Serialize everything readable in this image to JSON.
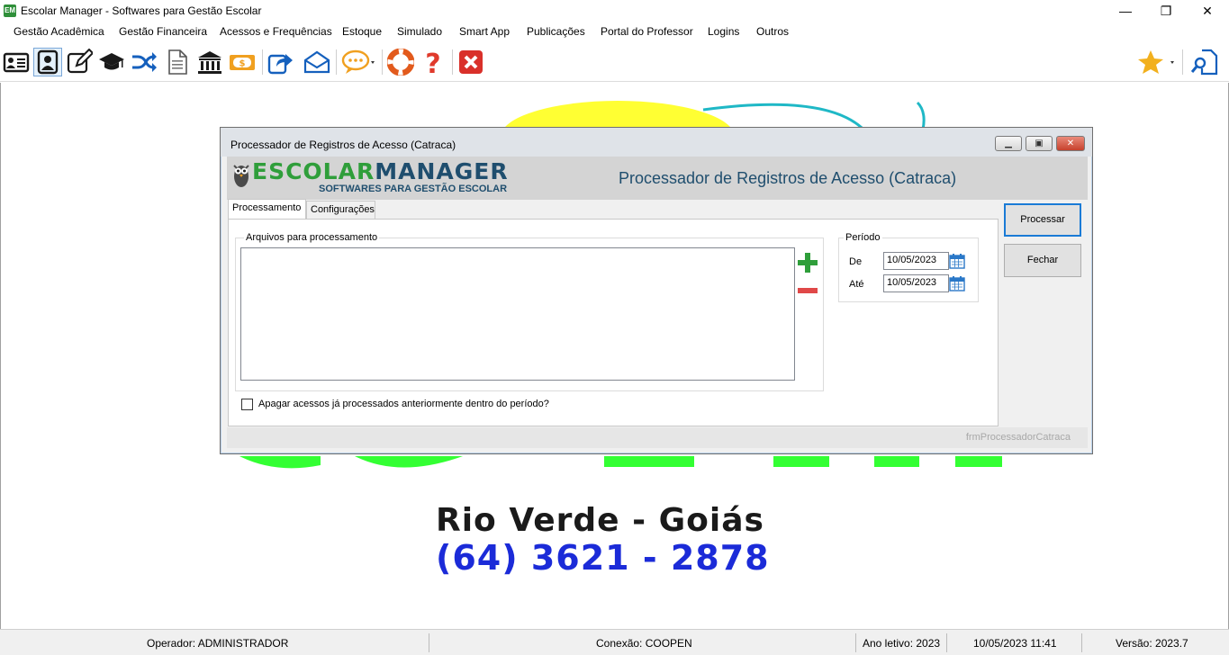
{
  "app": {
    "title": "Escolar Manager - Softwares para Gestão Escolar",
    "window_controls": {
      "minimize": "—",
      "maximize": "❐",
      "close": "✕"
    }
  },
  "menu": [
    {
      "label": "Gestão Acadêmica"
    },
    {
      "label": "Gestão Financeira"
    },
    {
      "label": "Acessos e Frequências"
    },
    {
      "label": "Estoque"
    },
    {
      "label": "Simulado"
    },
    {
      "label": "Smart App"
    },
    {
      "label": "Publicações"
    },
    {
      "label": "Portal do Professor"
    },
    {
      "label": "Logins"
    },
    {
      "label": "Outros"
    }
  ],
  "toolbar": {
    "icons": [
      "id-card-icon",
      "person-card-icon",
      "edit-icon",
      "graduation-cap-icon",
      "shuffle-icon",
      "document-icon",
      "bank-icon",
      "money-icon",
      "share-icon",
      "mail-icon",
      "chat-icon",
      "lifebuoy-icon",
      "help-icon",
      "close-icon",
      "star-icon",
      "search-doc-icon"
    ]
  },
  "background": {
    "city": "Rio Verde - Goiás",
    "phone": "(64) 3621 - 2878"
  },
  "dialog": {
    "title": "Processador de Registros de Acesso (Catraca)",
    "logo_word_1": "ESCOLAR",
    "logo_word_2": "MANAGER",
    "logo_tagline": "SOFTWARES PARA GESTÃO ESCOLAR",
    "heading": "Processador de Registros de Acesso (Catraca)",
    "tabs": [
      {
        "label": "Processamento",
        "active": true
      },
      {
        "label": "Configurações",
        "active": false
      }
    ],
    "files_group_label": "Arquivos para processamento",
    "period_group_label": "Período",
    "from_label": "De",
    "from_value": "10/05/2023",
    "to_label": "Até",
    "to_value": "10/05/2023",
    "checkbox_label": "Apagar acessos já processados anteriormente dentro do período?",
    "checkbox_checked": false,
    "process_button": "Processar",
    "close_button": "Fechar",
    "form_name": "frmProcessadorCatraca"
  },
  "status": {
    "operator": "Operador: ADMINISTRADOR",
    "connection": "Conexão: COOPEN",
    "school_year": "Ano letivo: 2023",
    "datetime": "10/05/2023 11:41",
    "version": "Versão: 2023.7"
  },
  "colors": {
    "accent_green": "#2f9e3a",
    "brand_blue": "#1f4e6e",
    "focus_blue": "#1a7bd6",
    "remove_red": "#e04848"
  }
}
